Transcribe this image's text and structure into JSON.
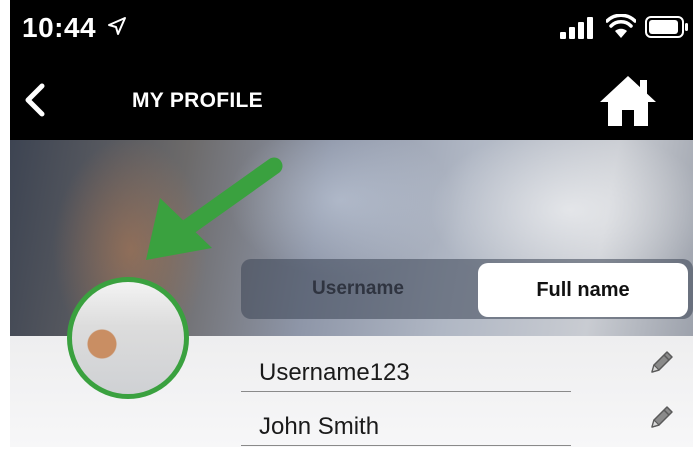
{
  "status_bar": {
    "time": "10:44",
    "location_icon": "location-arrow-icon",
    "signal_icon": "cellular-signal-icon",
    "wifi_icon": "wifi-icon",
    "battery_icon": "battery-icon"
  },
  "nav": {
    "title": "MY PROFILE",
    "back_icon": "chevron-left-icon",
    "home_icon": "home-icon"
  },
  "profile": {
    "avatar_ring_color": "#3aa13f",
    "annotation_arrow_color": "#3aa13f",
    "toggle": {
      "username_label": "Username",
      "fullname_label": "Full name",
      "selected": "Full name"
    },
    "fields": {
      "username_value": "Username123",
      "fullname_value": "John Smith",
      "edit_icon": "pencil-icon"
    }
  }
}
